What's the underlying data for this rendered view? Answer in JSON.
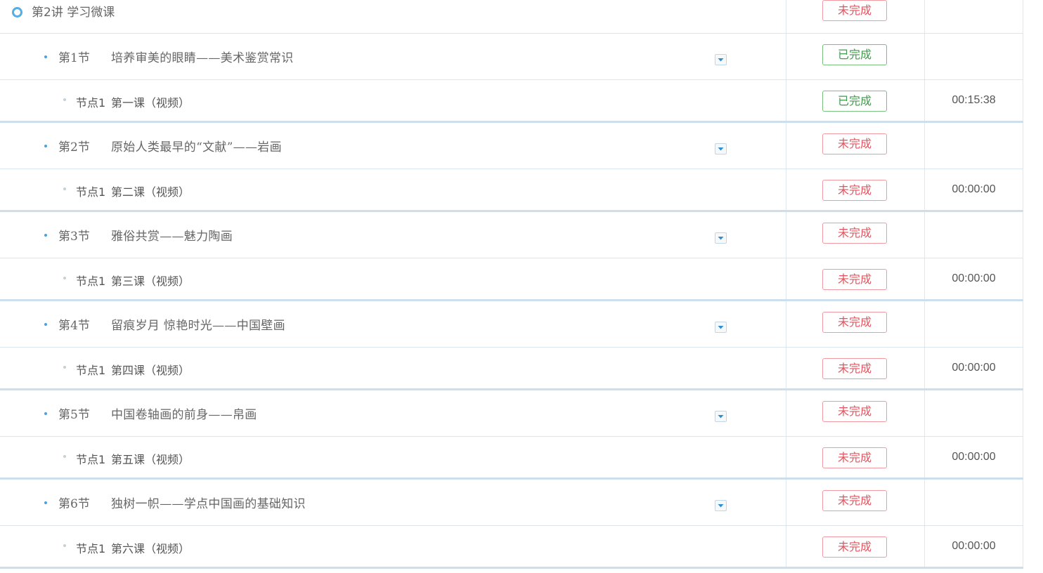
{
  "chapter": {
    "title": "第2讲  学习微课",
    "status": "未完成",
    "status_kind": "pending"
  },
  "sections": [
    {
      "number": "第1节",
      "title": "培养审美的眼睛——美术鉴赏常识",
      "status": "已完成",
      "status_kind": "done",
      "node": {
        "label": "节点1",
        "title": "第一课（视频）",
        "status": "已完成",
        "status_kind": "done",
        "duration": "00:15:38"
      }
    },
    {
      "number": "第2节",
      "title": "原始人类最早的“文献”——岩画",
      "status": "未完成",
      "status_kind": "pending",
      "node": {
        "label": "节点1",
        "title": "第二课（视频）",
        "status": "未完成",
        "status_kind": "pending",
        "duration": "00:00:00"
      }
    },
    {
      "number": "第3节",
      "title": "雅俗共赏——魅力陶画",
      "status": "未完成",
      "status_kind": "pending",
      "node": {
        "label": "节点1",
        "title": "第三课（视频）",
        "status": "未完成",
        "status_kind": "pending",
        "duration": "00:00:00"
      }
    },
    {
      "number": "第4节",
      "title": "留痕岁月  惊艳时光——中国壁画",
      "status": "未完成",
      "status_kind": "pending",
      "node": {
        "label": "节点1",
        "title": "第四课（视频）",
        "status": "未完成",
        "status_kind": "pending",
        "duration": "00:00:00"
      }
    },
    {
      "number": "第5节",
      "title": "中国卷轴画的前身——帛画",
      "status": "未完成",
      "status_kind": "pending",
      "node": {
        "label": "节点1",
        "title": "第五课（视频）",
        "status": "未完成",
        "status_kind": "pending",
        "duration": "00:00:00"
      }
    },
    {
      "number": "第6节",
      "title": "独树一帜——学点中国画的基础知识",
      "status": "未完成",
      "status_kind": "pending",
      "node": {
        "label": "节点1",
        "title": "第六课（视频）",
        "status": "未完成",
        "status_kind": "pending",
        "duration": "00:00:00"
      }
    }
  ],
  "colors": {
    "accent_blue": "#4aa2dc",
    "pending_red": "#e25560",
    "done_green": "#3f9a4b",
    "divider": "#cddfec"
  },
  "icons": {
    "chapter_marker": "ring-icon",
    "section_marker": "bullet-icon",
    "expand": "chevron-down-icon"
  }
}
